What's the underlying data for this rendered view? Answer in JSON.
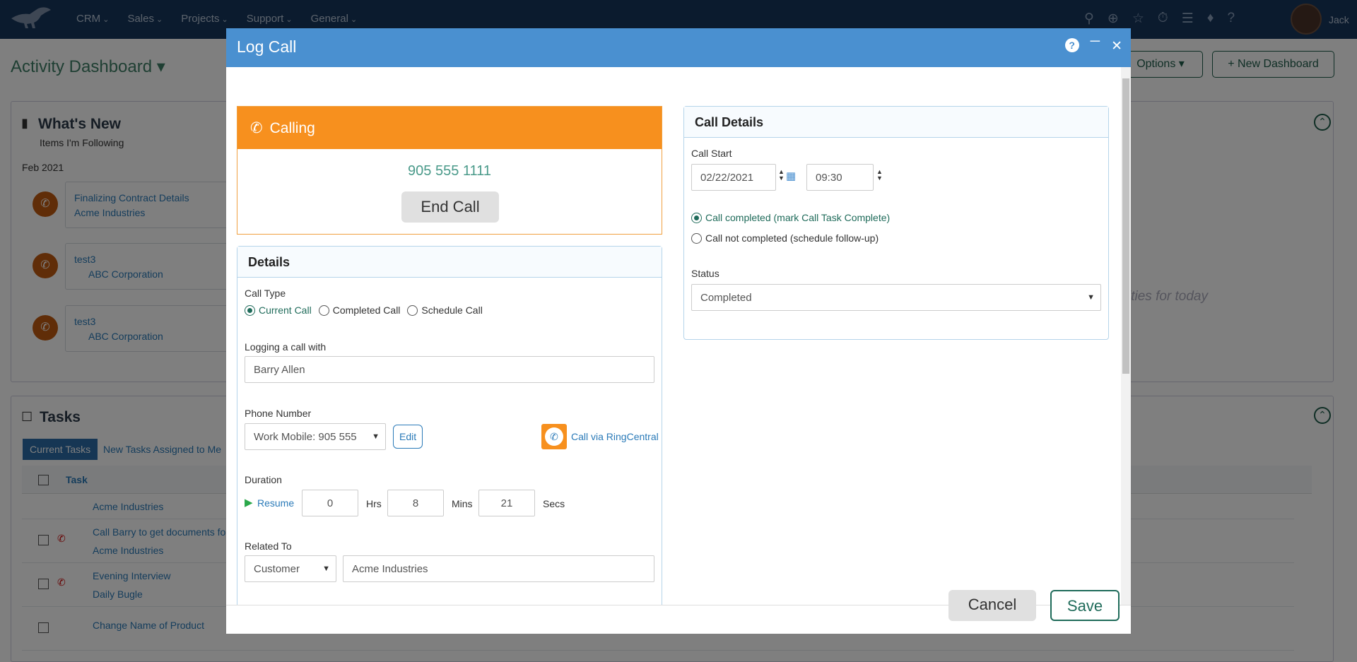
{
  "nav": {
    "menu": [
      "CRM",
      "Sales",
      "Projects",
      "Support",
      "General"
    ],
    "username": "Jack"
  },
  "background": {
    "dashboard_title": "Activity Dashboard",
    "options_button": "Options",
    "new_dashboard_button": "+ New Dashboard",
    "whats_new": {
      "title": "What's New",
      "subtitle": "Items I'm Following",
      "month": "Feb 2021",
      "items": [
        {
          "title": "Finalizing Contract Details",
          "company": "Acme Industries"
        },
        {
          "title": "test3",
          "company": "ABC Corporation"
        },
        {
          "title": "test3",
          "company": "ABC Corporation"
        }
      ],
      "empty_text": "ities for today"
    },
    "tasks": {
      "title": "Tasks",
      "tabs": [
        "Current Tasks",
        "New Tasks Assigned to Me"
      ],
      "column_task": "Task",
      "rows": [
        {
          "title": "",
          "sub": "Acme Industries"
        },
        {
          "title": "Call Barry to get documents for F",
          "sub": "Acme Industries"
        },
        {
          "title": "Evening Interview",
          "sub": "Daily Bugle"
        },
        {
          "title": "Change Name of Product",
          "sub": ""
        }
      ]
    }
  },
  "modal": {
    "title": "Log Call",
    "calling": {
      "label": "Calling",
      "number": "905 555 1111",
      "end_button": "End Call"
    },
    "details": {
      "title": "Details",
      "call_type_label": "Call Type",
      "call_types": [
        "Current Call",
        "Completed Call",
        "Schedule Call"
      ],
      "selected_call_type": "Current Call",
      "logging_label": "Logging a call with",
      "logging_value": "Barry Allen",
      "phone_label": "Phone Number",
      "phone_value": "Work Mobile: 905 555",
      "edit_button": "Edit",
      "ringcentral_label": "Call via RingCentral",
      "duration_label": "Duration",
      "resume_label": "Resume",
      "hours": "0",
      "hours_unit": "Hrs",
      "mins": "8",
      "mins_unit": "Mins",
      "secs": "21",
      "secs_unit": "Secs",
      "related_label": "Related To",
      "related_type": "Customer",
      "related_value": "Acme Industries"
    },
    "call_details": {
      "title": "Call Details",
      "call_start_label": "Call Start",
      "date": "02/22/2021",
      "time": "09:30",
      "completed_option": "Call completed (mark Call Task Complete)",
      "not_completed_option": "Call not completed (schedule follow-up)",
      "status_label": "Status",
      "status_value": "Completed"
    },
    "footer": {
      "cancel": "Cancel",
      "save": "Save"
    }
  },
  "colors": {
    "nav_bg": "#17365c",
    "modal_header": "#4a90d0",
    "calling_orange": "#f7901e",
    "accent_green": "#1f6b5a"
  }
}
